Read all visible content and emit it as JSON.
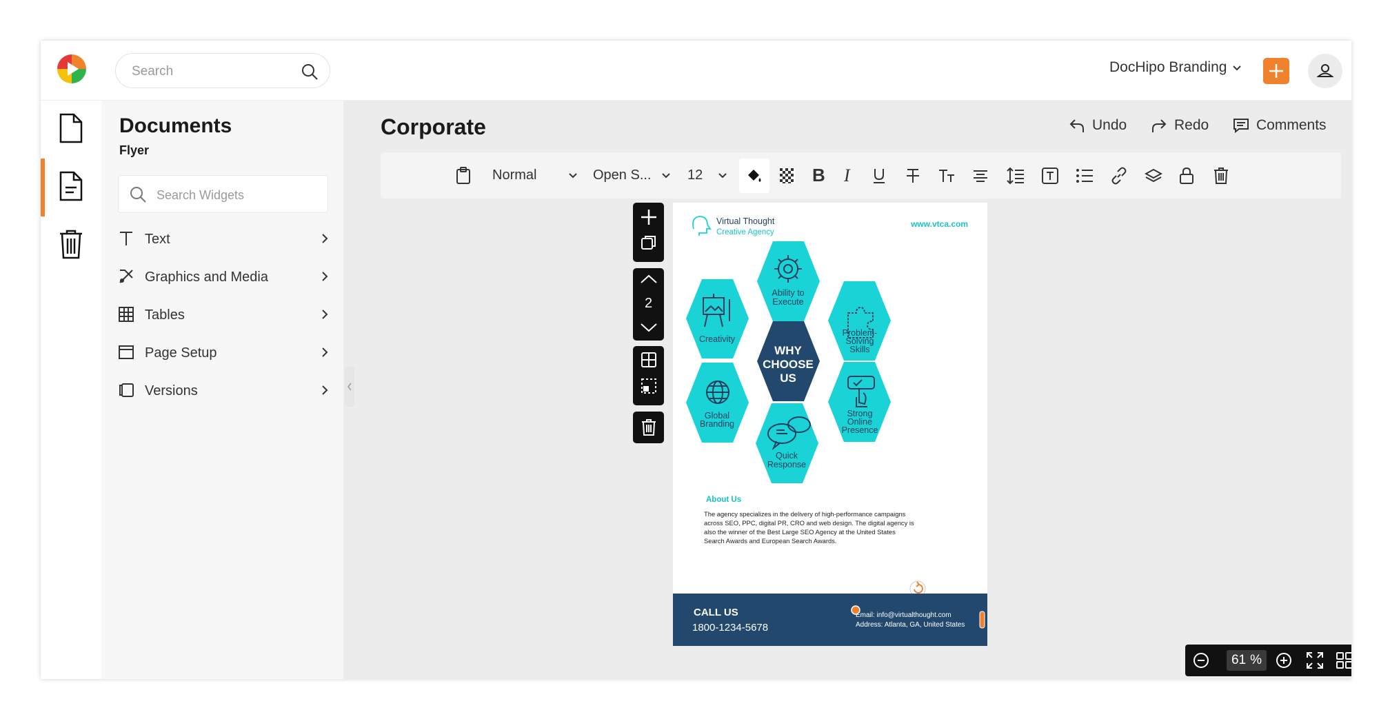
{
  "header": {
    "search_placeholder": "Search",
    "brand": "DocHipo Branding"
  },
  "panel": {
    "title": "Documents",
    "subtitle": "Flyer",
    "widget_search_placeholder": "Search Widgets",
    "items": [
      {
        "label": "Text",
        "icon": "text-icon"
      },
      {
        "label": "Graphics and Media",
        "icon": "graphics-icon"
      },
      {
        "label": "Tables",
        "icon": "table-icon"
      },
      {
        "label": "Page Setup",
        "icon": "page-setup-icon"
      },
      {
        "label": "Versions",
        "icon": "versions-icon"
      }
    ]
  },
  "main": {
    "title": "Corporate",
    "undo": "Undo",
    "redo": "Redo",
    "comments": "Comments"
  },
  "toolbar": {
    "style": "Normal",
    "font": "Open S...",
    "size": "12"
  },
  "page_tools": {
    "page_number": "2"
  },
  "flyer": {
    "brand_line1": "Virtual Thought",
    "brand_line2": "Creative Agency",
    "website": "www.vtca.com",
    "center_line1": "WHY",
    "center_line2": "CHOOSE",
    "center_line3": "US",
    "hex_top": [
      "Ability to",
      "Execute"
    ],
    "hex_creativity": [
      "Creativity"
    ],
    "hex_problem": [
      "Problem-",
      "Solving",
      "Skills"
    ],
    "hex_global": [
      "Global",
      "Branding"
    ],
    "hex_strong": [
      "Strong",
      "Online",
      "Presence"
    ],
    "hex_quick": [
      "Quick",
      "Response"
    ],
    "about_title": "About Us",
    "about_lines": [
      "The agency specializes in the delivery of high-performance campaigns",
      "across SEO, PPC, digital PR, CRO and web design. The digital agency is",
      "also the winner of the Best Large SEO Agency at the United States",
      "Search Awards and European Search Awards."
    ],
    "call_label": "CALL US",
    "phone": "1800-1234-5678",
    "email": "Email: info@virtualthought.com",
    "address": "Address: Atlanta, GA, United States"
  },
  "zoom": {
    "value": "61",
    "unit": "%"
  },
  "colors": {
    "accent": "#f0822d",
    "teal": "#19d3d6",
    "navy": "#22486e"
  }
}
